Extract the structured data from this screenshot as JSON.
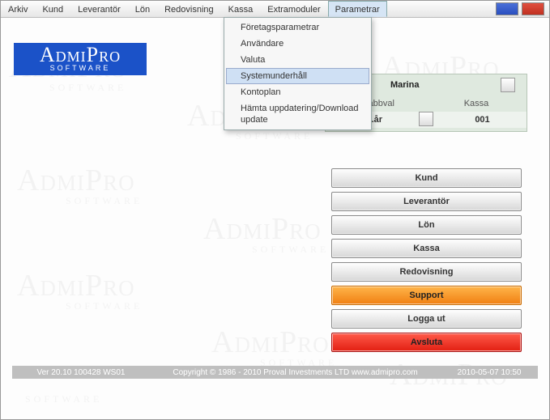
{
  "menu": {
    "items": [
      "Arkiv",
      "Kund",
      "Leverantör",
      "Lön",
      "Redovisning",
      "Kassa",
      "Extramoduler",
      "Parametrar"
    ],
    "open_index": 7
  },
  "dropdown": {
    "items": [
      "Företagsparametrar",
      "Användare",
      "Valuta",
      "Systemunderhåll",
      "Kontoplan",
      "Hämta uppdatering/Download update"
    ],
    "highlight_index": 3
  },
  "logo": {
    "line1": "AdmiPro",
    "line2": "SOFTWARE"
  },
  "panel": {
    "name_value": "Marina",
    "col1_label": "Snabbval",
    "col2_label": "Kassa",
    "aktar_label": "Akt.år",
    "kassa_value": "001"
  },
  "buttons": {
    "kund": "Kund",
    "leverantor": "Leverantör",
    "lon": "Lön",
    "kassa": "Kassa",
    "redovisning": "Redovisning",
    "support": "Support",
    "loggaut": "Logga ut",
    "avsluta": "Avsluta"
  },
  "status": {
    "version": "Ver 20.10 100428 WS01",
    "copyright": "Copyright © 1986 - 2010 Proval Investments LTD www.admipro.com",
    "datetime": "2010-05-07 10:50"
  },
  "watermark": {
    "big": "AdmiPro",
    "small": "SOFTWARE"
  }
}
